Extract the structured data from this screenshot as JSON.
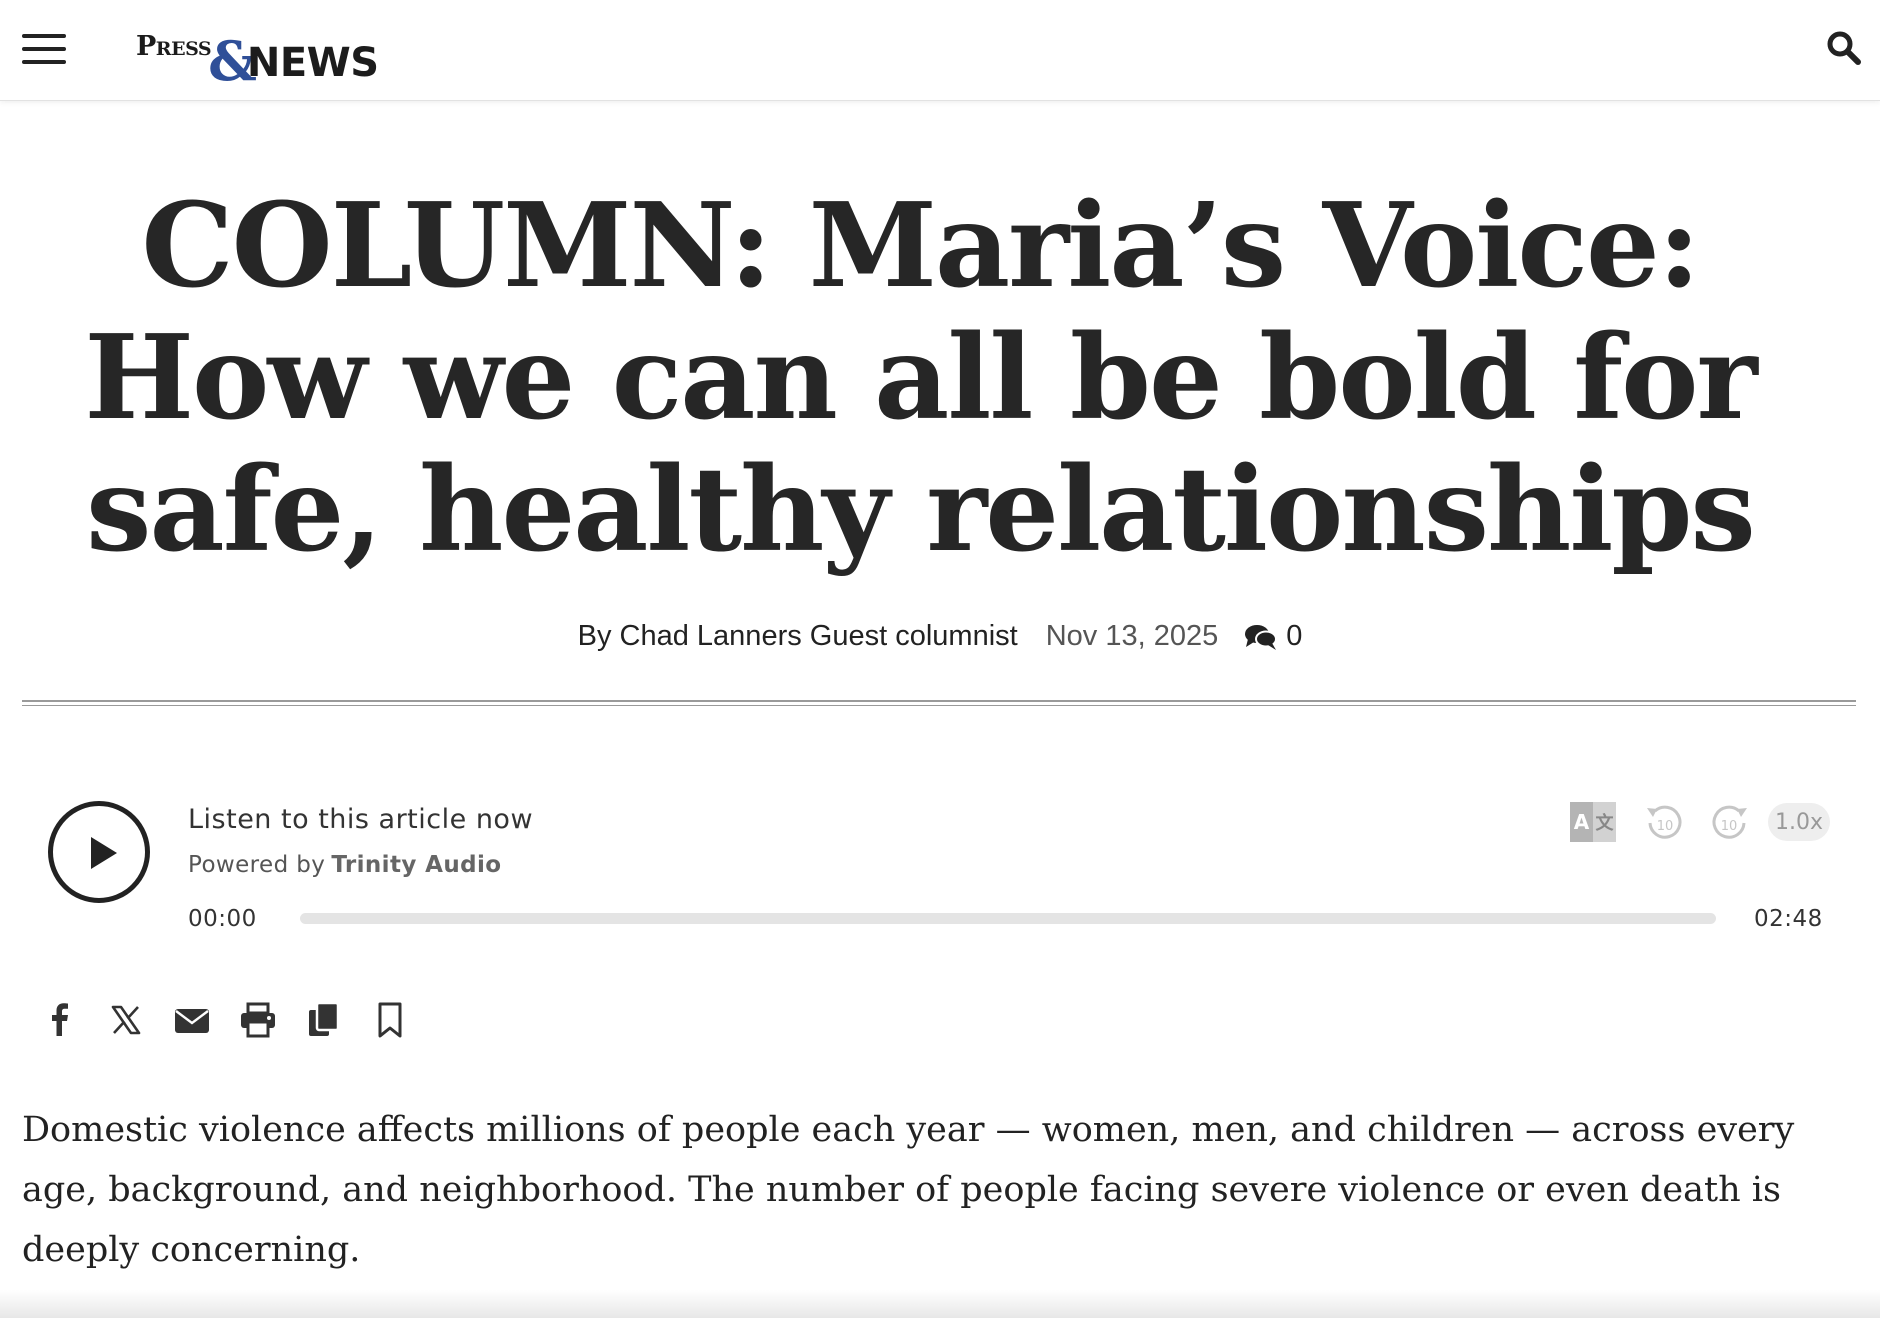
{
  "header": {
    "logo_press": "Press",
    "logo_amp": "&",
    "logo_news": "NEWS",
    "menu_icon": "hamburger-icon",
    "search_icon": "search-icon"
  },
  "article": {
    "headline": "COLUMN: Maria’s Voice: How we can all be bold for safe, healthy relationships",
    "byline": "By Chad Lanners Guest columnist",
    "date": "Nov 13, 2025",
    "comment_count": "0",
    "body": "Domestic violence affects millions of people each year — women, men, and children — across every age, background, and neighborhood. The number of people facing severe violence or even death is deeply concerning."
  },
  "audio_player": {
    "title": "Listen to this article now",
    "powered_by": "Powered by",
    "brand": "Trinity Audio",
    "current_time": "00:00",
    "total_time": "02:48",
    "speed": "1.0x",
    "progress": 0,
    "skip_seconds": "10"
  },
  "share_icons": [
    "facebook-icon",
    "x-icon",
    "email-icon",
    "print-icon",
    "copy-icon",
    "bookmark-icon"
  ],
  "colors": {
    "logo_accent": "#2f4f98",
    "text": "#222222",
    "progress_track": "#e4e4e4"
  }
}
